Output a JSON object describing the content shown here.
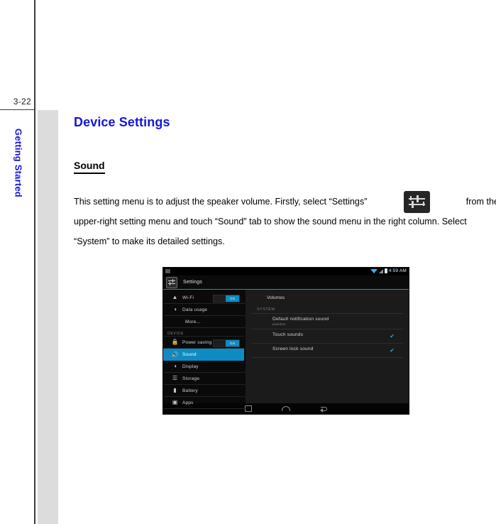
{
  "page": {
    "number": "3-22",
    "chapter_tab": "Getting Started"
  },
  "content": {
    "heading": "Device Settings",
    "subheading": "Sound",
    "paragraph_line1_a": "This setting menu is to adjust the speaker volume. Firstly, select “Settings”",
    "paragraph_line1_b": "from the",
    "paragraph_line2": "upper-right setting menu and touch “Sound” tab to show the sound menu in the right column. Select",
    "paragraph_line3": "“System” to make its detailed settings.",
    "inline_icon": "settings-sliders-icon"
  },
  "screenshot": {
    "statusbar": {
      "notification_icon": "screenshot-icon",
      "wifi_icon": "wifi-icon",
      "signal_icon": "signal-icon",
      "battery_icon": "battery-icon",
      "clock": "4:59 AM"
    },
    "titlebar": {
      "app_icon": "settings-sliders-icon",
      "title": "Settings"
    },
    "sidebar": {
      "items": [
        {
          "label": "Wi-Fi",
          "icon": "wifi-icon",
          "toggle": "ON",
          "type": "toggle"
        },
        {
          "label": "Data usage",
          "icon": "data-usage-icon",
          "type": "plain"
        },
        {
          "label": "More...",
          "icon": "",
          "type": "indent"
        },
        {
          "label": "DEVICE",
          "type": "group"
        },
        {
          "label": "Power saving",
          "icon": "power-saving-icon",
          "toggle": "ON",
          "type": "toggle"
        },
        {
          "label": "Sound",
          "icon": "sound-icon",
          "type": "selected"
        },
        {
          "label": "Display",
          "icon": "display-icon",
          "type": "plain"
        },
        {
          "label": "Storage",
          "icon": "storage-icon",
          "type": "plain"
        },
        {
          "label": "Battery",
          "icon": "battery-icon",
          "type": "plain"
        },
        {
          "label": "Apps",
          "icon": "apps-icon",
          "type": "plain"
        }
      ]
    },
    "detail": {
      "header": "Volumes",
      "group": "SYSTEM",
      "items": [
        {
          "title": "Default notification sound",
          "subtitle": "pixiedust",
          "checked": false
        },
        {
          "title": "Touch sounds",
          "subtitle": "",
          "checked": true
        },
        {
          "title": "Screen lock sound",
          "subtitle": "",
          "checked": true
        }
      ],
      "check_glyph": "✔"
    },
    "navbar": {
      "recents": "recents-icon",
      "home": "home-icon",
      "back": "back-icon"
    }
  },
  "colors": {
    "accent_blue": "#0d8cc4",
    "heading_blue": "#1414e0",
    "side_gray": "#dcdcdc"
  }
}
